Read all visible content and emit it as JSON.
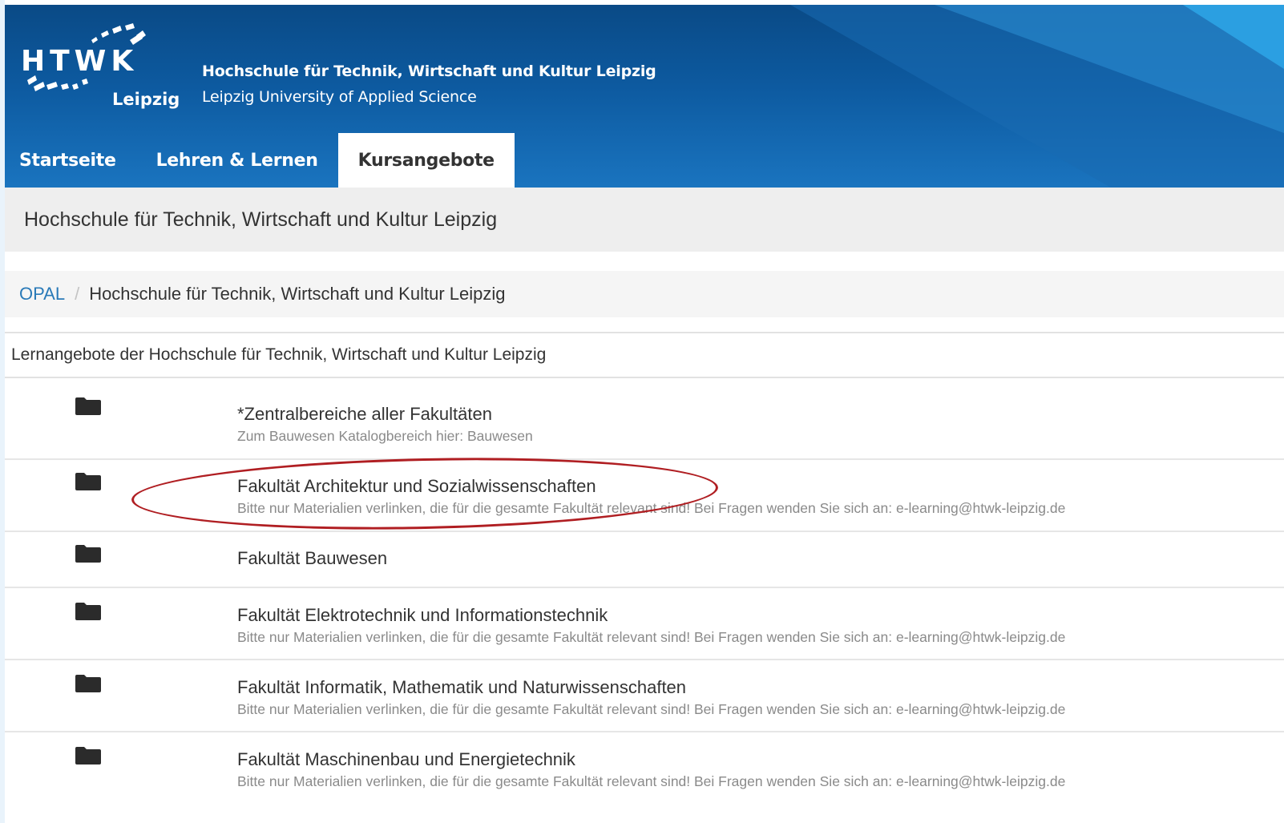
{
  "header": {
    "logo_text": "HTWK",
    "logo_city": "Leipzig",
    "uni_name": "Hochschule für Technik, Wirtschaft und Kultur Leipzig",
    "uni_sub": "Leipzig University of Applied Science",
    "colors": {
      "primary": "#0d5aa0",
      "light": "#1a74bf",
      "accent": "#2ea6e8"
    }
  },
  "nav": {
    "items": [
      {
        "label": "Startseite",
        "active": false
      },
      {
        "label": "Lehren & Lernen",
        "active": false
      },
      {
        "label": "Kursangebote",
        "active": true
      }
    ]
  },
  "page_title": "Hochschule für Technik, Wirtschaft und Kultur Leipzig",
  "breadcrumb": {
    "root": "OPAL",
    "separator": "/",
    "current": "Hochschule für Technik, Wirtschaft und Kultur Leipzig"
  },
  "catalog": {
    "heading": "Lernangebote der Hochschule für Technik, Wirtschaft und Kultur Leipzig",
    "entries": [
      {
        "icon": "folder-icon",
        "title": "*Zentralbereiche aller Fakultäten",
        "desc": "Zum Bauwesen Katalogbereich hier: Bauwesen"
      },
      {
        "icon": "folder-icon",
        "title": "Fakultät Architektur und Sozialwissenschaften",
        "desc": "Bitte nur Materialien verlinken, die für die gesamte Fakultät relevant sind! Bei Fragen wenden Sie sich an: e-learning@htwk-leipzig.de"
      },
      {
        "icon": "folder-icon",
        "title": "Fakultät Bauwesen",
        "desc": ""
      },
      {
        "icon": "folder-icon",
        "title": "Fakultät Elektrotechnik und Informationstechnik",
        "desc": "Bitte nur Materialien verlinken, die für die gesamte Fakultät relevant sind! Bei Fragen wenden Sie sich an: e-learning@htwk-leipzig.de"
      },
      {
        "icon": "folder-icon",
        "title": "Fakultät Informatik, Mathematik und Naturwissenschaften",
        "desc": "Bitte nur Materialien verlinken, die für die gesamte Fakultät relevant sind! Bei Fragen wenden Sie sich an: e-learning@htwk-leipzig.de"
      },
      {
        "icon": "folder-icon",
        "title": "Fakultät Maschinenbau und Energietechnik",
        "desc": "Bitte nur Materialien verlinken, die für die gesamte Fakultät relevant sind! Bei Fragen wenden Sie sich an: e-learning@htwk-leipzig.de"
      }
    ]
  },
  "annotation": {
    "highlight_color": "#b01e22"
  }
}
